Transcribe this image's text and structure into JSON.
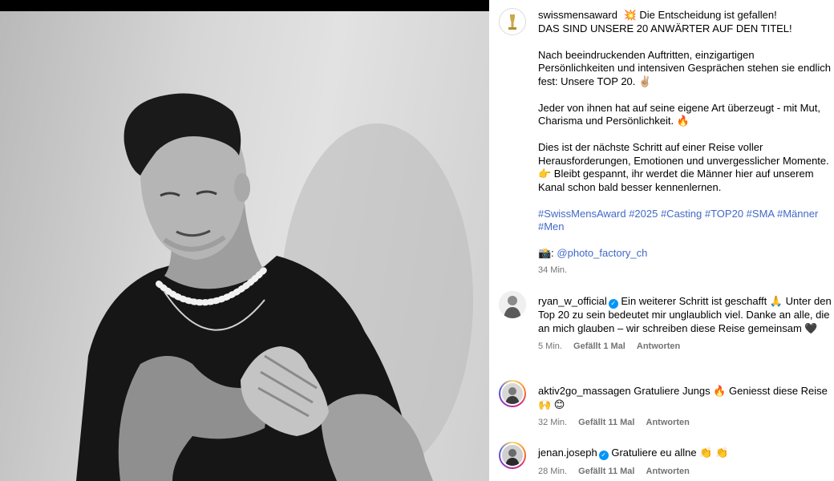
{
  "caption": {
    "username": "swissmensaward",
    "lines": [
      "💥 Die Entscheidung ist gefallen!",
      "DAS SIND UNSERE 20 ANWÄRTER AUF DEN TITEL!"
    ],
    "para1": "Nach beeindruckenden Auftritten, einzigartigen Persönlichkeiten und intensiven Gesprächen stehen sie endlich fest: Unsere TOP 20. ✌🏼",
    "para2": "Jeder von ihnen hat auf seine eigene Art überzeugt - mit Mut, Charisma und Persönlichkeit. 🔥",
    "para3": "Dies ist der nächste Schritt auf einer Reise voller Herausforderungen, Emotionen und unvergesslicher Momente. 👉 Bleibt gespannt, ihr werdet die Männer hier auf unserem Kanal schon bald besser kennenlernen.",
    "hashtags": "#SwissMensAward #2025 #Casting #TOP20 #SMA #Männer #Men",
    "credit_prefix": "📸: ",
    "credit_handle": "@photo_factory_ch",
    "time": "34 Min."
  },
  "comments": [
    {
      "username": "ryan_w_official",
      "verified": true,
      "text": "Ein weiterer Schritt ist geschafft 🙏 Unter den Top 20 zu sein bedeutet mir unglaublich viel. Danke an alle, die an mich glauben – wir schreiben diese Reise gemeinsam 🖤",
      "time": "5 Min.",
      "likes": "Gefällt 1 Mal",
      "reply": "Antworten"
    },
    {
      "username": "aktiv2go_massagen",
      "verified": false,
      "text": "Gratuliere Jungs 🔥 Geniesst diese Reise🙌 😊",
      "time": "32 Min.",
      "likes": "Gefällt 11 Mal",
      "reply": "Antworten"
    },
    {
      "username": "jenan.joseph",
      "verified": true,
      "text": "Gratuliere eu allne 👏 👏",
      "time": "28 Min.",
      "likes": "Gefällt 11 Mal",
      "reply": "Antworten"
    }
  ],
  "icons": {
    "verified": "✓"
  }
}
